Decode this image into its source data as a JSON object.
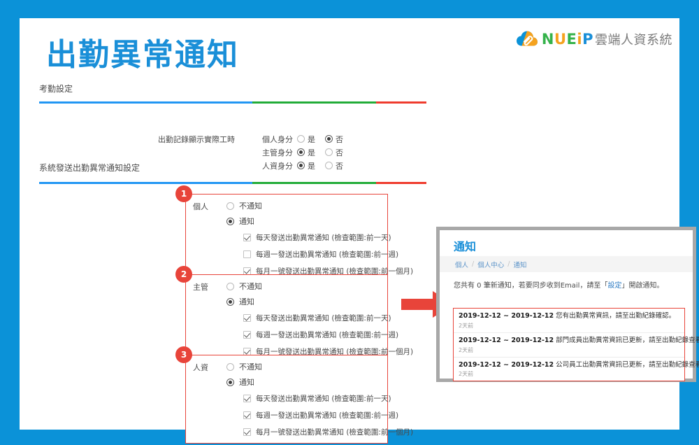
{
  "theme": {
    "frame_blue": "#0b92d8",
    "title_blue": "#1a8fd8",
    "accent_red": "#e8443a",
    "divider_blue": "#2196f3",
    "divider_green": "#22ac38",
    "divider_red": "#ef3b2d"
  },
  "header": {
    "title": "出勤異常通知",
    "brand": {
      "logo_icon": "cloud-paperclip-icon",
      "letters": [
        "N",
        "U",
        "E",
        "i",
        "P"
      ],
      "subtitle": "雲端人資系統"
    }
  },
  "sections": {
    "attendance_settings_label": "考勤設定",
    "system_notify_label": "系統發送出勤異常通知設定"
  },
  "work_hours": {
    "caption": "出勤記錄顯示實際工時",
    "option_yes": "是",
    "option_no": "否",
    "rows": [
      {
        "name": "個人身分",
        "selected": "否"
      },
      {
        "name": "主管身分",
        "selected": "是"
      },
      {
        "name": "人資身分",
        "selected": "是"
      }
    ]
  },
  "notify_groups": [
    {
      "badge": "1",
      "role": "個人",
      "radio_off": "不通知",
      "radio_on": "通知",
      "selected": "通知",
      "checks": [
        {
          "label": "每天發送出勤異常通知 (檢查範圍:前一天)",
          "checked": true
        },
        {
          "label": "每週一發送出勤異常通知 (檢查範圍:前一週)",
          "checked": false
        },
        {
          "label": "每月一號發送出勤異常通知 (檢查範圍:前一個月)",
          "checked": true
        }
      ]
    },
    {
      "badge": "2",
      "role": "主管",
      "radio_off": "不通知",
      "radio_on": "通知",
      "selected": "通知",
      "checks": [
        {
          "label": "每天發送出勤異常通知 (檢查範圍:前一天)",
          "checked": true
        },
        {
          "label": "每週一發送出勤異常通知 (檢查範圍:前一週)",
          "checked": true
        },
        {
          "label": "每月一號發送出勤異常通知 (檢查範圍:前一個月)",
          "checked": true
        }
      ]
    },
    {
      "badge": "3",
      "role": "人資",
      "radio_off": "不通知",
      "radio_on": "通知",
      "selected": "通知",
      "checks": [
        {
          "label": "每天發送出勤異常通知 (檢查範圍:前一天)",
          "checked": true
        },
        {
          "label": "每週一發送出勤異常通知 (檢查範圍:前一週)",
          "checked": true
        },
        {
          "label": "每月一號發送出勤異常通知 (檢查範圍:前一個月)",
          "checked": true
        }
      ]
    }
  ],
  "arrow": {
    "icon": "arrow-right-icon",
    "color": "#e8443a"
  },
  "notification_panel": {
    "title": "通知",
    "breadcrumb": [
      "個人",
      "個人中心",
      "通知"
    ],
    "breadcrumb_separator": "/",
    "message_prefix": "您共有 0 筆新通知，若要同步收到Email，請至「",
    "message_link": "設定",
    "message_suffix": "」開啟通知。",
    "items": [
      {
        "date": "2019-12-12 ~ 2019-12-12",
        "text": "您有出勤異常資訊，請至出勤紀錄確認。",
        "time": "2天前"
      },
      {
        "date": "2019-12-12 ~ 2019-12-12",
        "text": "部門成員出勤異常資訊已更新，請至出勤紀錄查看。",
        "time": "2天前"
      },
      {
        "date": "2019-12-12 ~ 2019-12-12",
        "text": "公司員工出勤異常資訊已更新，請至出勤紀錄查看。",
        "time": "2天前"
      }
    ]
  }
}
